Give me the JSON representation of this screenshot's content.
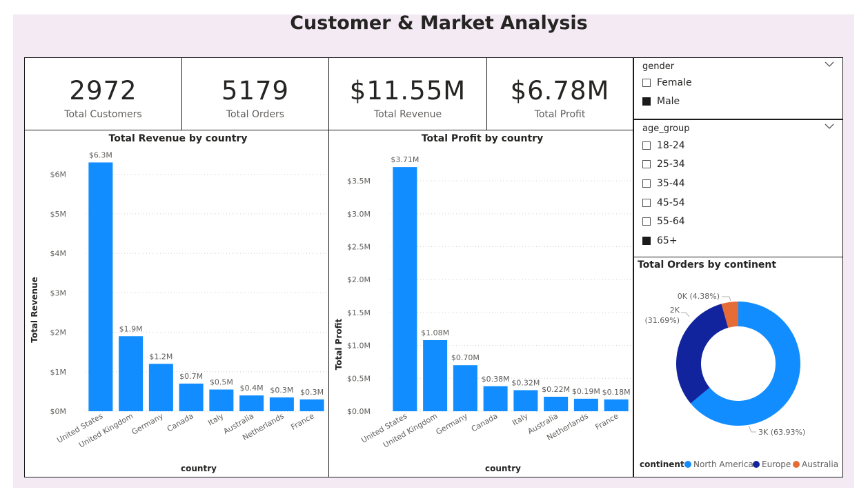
{
  "title": "Customer & Market Analysis",
  "kpis": [
    {
      "value": "2972",
      "label": "Total Customers"
    },
    {
      "value": "5179",
      "label": "Total Orders"
    },
    {
      "value": "$11.55M",
      "label": "Total Revenue"
    },
    {
      "value": "$6.78M",
      "label": "Total Profit"
    }
  ],
  "slicers": {
    "gender": {
      "title": "gender",
      "options": [
        {
          "label": "Female",
          "checked": false
        },
        {
          "label": "Male",
          "checked": true
        }
      ]
    },
    "age_group": {
      "title": "age_group",
      "options": [
        {
          "label": "18-24",
          "checked": false
        },
        {
          "label": "25-34",
          "checked": false
        },
        {
          "label": "35-44",
          "checked": false
        },
        {
          "label": "45-54",
          "checked": false
        },
        {
          "label": "55-64",
          "checked": false
        },
        {
          "label": "65+",
          "checked": true
        }
      ]
    }
  },
  "colors": {
    "bar": "#118dff",
    "north_america": "#118dff",
    "europe": "#12239e",
    "australia": "#e66c37"
  },
  "chart_data": [
    {
      "type": "bar",
      "title": "Total Revenue by country",
      "xlabel": "country",
      "ylabel": "Total Revenue",
      "categories": [
        "United States",
        "United Kingdom",
        "Germany",
        "Canada",
        "Italy",
        "Australia",
        "Netherlands",
        "France"
      ],
      "values": [
        6.3,
        1.9,
        1.2,
        0.7,
        0.55,
        0.4,
        0.35,
        0.3
      ],
      "value_labels": [
        "$6.3M",
        "$1.9M",
        "$1.2M",
        "$0.7M",
        "$0.5M",
        "$0.4M",
        "$0.3M",
        "$0.3M"
      ],
      "yticks": [
        0,
        1,
        2,
        3,
        4,
        5,
        6
      ],
      "ytick_labels": [
        "$0M",
        "$1M",
        "$2M",
        "$3M",
        "$4M",
        "$5M",
        "$6M"
      ],
      "ylim": [
        0,
        6.5
      ],
      "grid": true
    },
    {
      "type": "bar",
      "title": "Total Profit by country",
      "xlabel": "country",
      "ylabel": "Total Profit",
      "categories": [
        "United States",
        "United Kingdom",
        "Germany",
        "Canada",
        "Italy",
        "Australia",
        "Netherlands",
        "France"
      ],
      "values": [
        3.71,
        1.08,
        0.7,
        0.38,
        0.32,
        0.22,
        0.19,
        0.18
      ],
      "value_labels": [
        "$3.71M",
        "$1.08M",
        "$0.70M",
        "$0.38M",
        "$0.32M",
        "$0.22M",
        "$0.19M",
        "$0.18M"
      ],
      "yticks": [
        0,
        0.5,
        1.0,
        1.5,
        2.0,
        2.5,
        3.0,
        3.5
      ],
      "ytick_labels": [
        "$0.0M",
        "$0.5M",
        "$1.0M",
        "$1.5M",
        "$2.0M",
        "$2.5M",
        "$3.0M",
        "$3.5M"
      ],
      "ylim": [
        0,
        3.9
      ],
      "grid": true
    },
    {
      "type": "pie",
      "title": "Total Orders by continent",
      "legend_title": "continent",
      "legend_position": "bottom",
      "slices": [
        {
          "name": "North America",
          "percent": 63.93,
          "label": "3K (63.93%)"
        },
        {
          "name": "Europe",
          "percent": 31.69,
          "label": "2K",
          "label2": "(31.69%)"
        },
        {
          "name": "Australia",
          "percent": 4.38,
          "label": "0K (4.38%)"
        }
      ]
    }
  ]
}
